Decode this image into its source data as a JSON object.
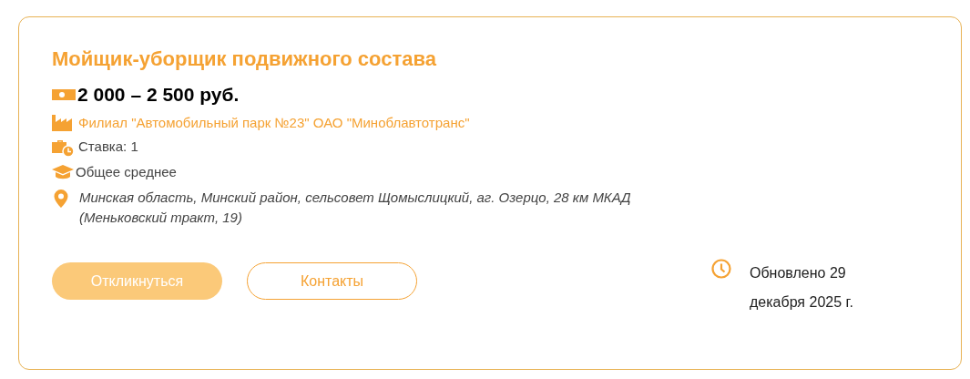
{
  "vacancy": {
    "title": "Мойщик-уборщик подвижного состава",
    "details": [
      {
        "kind": "salary",
        "text": "2 000 – 2 500 руб."
      },
      {
        "kind": "employer",
        "text": "Филиал \"Автомобильный парк №23\" ОАО \"Миноблавтотранс\""
      },
      {
        "kind": "rate",
        "text": "Ставка: 1"
      },
      {
        "kind": "education",
        "text": "Общее среднее"
      },
      {
        "kind": "address",
        "text": "Минская область, Минский район, сельсовет Щомыслицкий, аг. Озерцо, 28 км МКАД (Меньковский тракт, 19)"
      }
    ],
    "buttons": [
      {
        "kind": "primary",
        "label": "Откликнуться"
      },
      {
        "kind": "outline",
        "label": "Контакты"
      }
    ],
    "updated": "Обновлено 29 декабря 2025 г."
  }
}
